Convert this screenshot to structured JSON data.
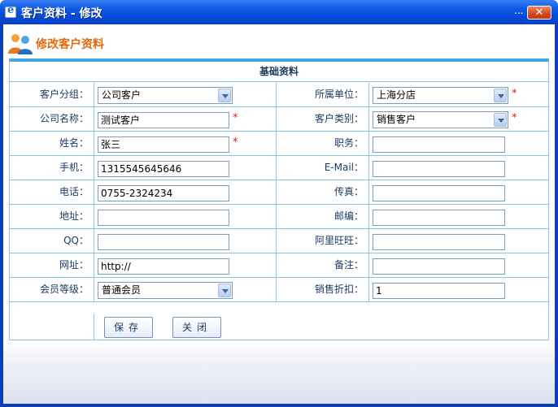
{
  "window": {
    "title": "客户资料 - 修改",
    "menu_dots": "...",
    "close_glyph": "✕"
  },
  "header": {
    "title": "修改客户资料"
  },
  "form": {
    "section_title": "基础资料",
    "required_mark": "*",
    "fields": {
      "customer_group": {
        "label": "客户分组：",
        "value": "公司客户"
      },
      "unit": {
        "label": "所属单位：",
        "value": "上海分店"
      },
      "company_name": {
        "label": "公司名称：",
        "value": "测试客户"
      },
      "customer_type": {
        "label": "客户类别：",
        "value": "销售客户"
      },
      "name": {
        "label": "姓名：",
        "value": "张三"
      },
      "position": {
        "label": "职务：",
        "value": ""
      },
      "mobile": {
        "label": "手机：",
        "value": "1315545645646"
      },
      "email": {
        "label": "E-Mail：",
        "value": ""
      },
      "phone": {
        "label": "电话：",
        "value": "0755-2324234"
      },
      "fax": {
        "label": "传真：",
        "value": ""
      },
      "address": {
        "label": "地址：",
        "value": ""
      },
      "postcode": {
        "label": "邮编：",
        "value": ""
      },
      "qq": {
        "label": "QQ：",
        "value": ""
      },
      "aliwangwang": {
        "label": "阿里旺旺：",
        "value": ""
      },
      "website": {
        "label": "网址：",
        "value": "http://"
      },
      "remark": {
        "label": "备注：",
        "value": ""
      },
      "member_level": {
        "label": "会员等级：",
        "value": "普通会员"
      },
      "discount": {
        "label": "销售折扣：",
        "value": "1"
      }
    },
    "buttons": {
      "save": "保存",
      "close": "关闭"
    }
  },
  "colors": {
    "title_bar": "#0a4fd8",
    "border": "#8cc5e4",
    "accent": "#3fa9de",
    "header_text": "#e06a10",
    "required": "#e02020"
  },
  "icons": {
    "app": "ie-icon",
    "header": "users-icon",
    "dropdown": "chevron-down-icon"
  }
}
